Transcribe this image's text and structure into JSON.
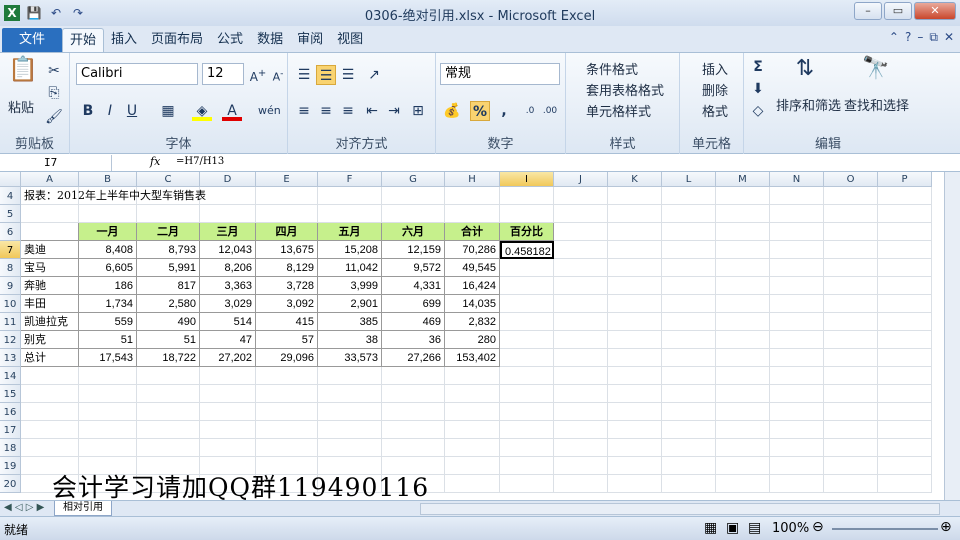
{
  "window": {
    "title": "0306-绝对引用.xlsx - Microsoft Excel"
  },
  "tabs": [
    "文件",
    "开始",
    "插入",
    "页面布局",
    "公式",
    "数据",
    "审阅",
    "视图"
  ],
  "ribbon": {
    "clipboard": {
      "label": "剪贴板",
      "paste": "粘贴"
    },
    "font": {
      "label": "字体",
      "name": "Calibri",
      "size": "12"
    },
    "align": {
      "label": "对齐方式"
    },
    "number": {
      "label": "数字",
      "format": "常规"
    },
    "styles": {
      "label": "样式",
      "cond": "条件格式",
      "table": "套用表格格式",
      "cell": "单元格样式"
    },
    "cells": {
      "label": "单元格",
      "insert": "插入",
      "delete": "删除",
      "format": "格式"
    },
    "edit": {
      "label": "编辑",
      "sort": "排序和筛选",
      "find": "查找和选择"
    }
  },
  "formula": {
    "namebox": "I7",
    "fx": "fx",
    "text": "=H7/H13"
  },
  "sheet": {
    "columns": [
      "A",
      "B",
      "C",
      "D",
      "E",
      "F",
      "G",
      "H",
      "I",
      "J",
      "K",
      "L",
      "M",
      "N",
      "O",
      "P"
    ],
    "rows": [
      "4",
      "5",
      "6",
      "7",
      "8",
      "9",
      "10",
      "11",
      "12",
      "13",
      "14",
      "15",
      "16",
      "17",
      "18",
      "19",
      "20"
    ],
    "title": "报表：2012年上半年中大型车销售表",
    "headers": [
      "一月",
      "二月",
      "三月",
      "四月",
      "五月",
      "六月",
      "合计",
      "百分比"
    ],
    "data": [
      [
        "奥迪",
        "8,408",
        "8,793",
        "12,043",
        "13,675",
        "15,208",
        "12,159",
        "70,286",
        "0.458182"
      ],
      [
        "宝马",
        "6,605",
        "5,991",
        "8,206",
        "8,129",
        "11,042",
        "9,572",
        "49,545",
        ""
      ],
      [
        "奔驰",
        "186",
        "817",
        "3,363",
        "3,728",
        "3,999",
        "4,331",
        "16,424",
        ""
      ],
      [
        "丰田",
        "1,734",
        "2,580",
        "3,029",
        "3,092",
        "2,901",
        "699",
        "14,035",
        ""
      ],
      [
        "凯迪拉克",
        "559",
        "490",
        "514",
        "415",
        "385",
        "469",
        "2,832",
        ""
      ],
      [
        "别克",
        "51",
        "51",
        "47",
        "57",
        "38",
        "36",
        "280",
        ""
      ],
      [
        "总计",
        "17,543",
        "18,722",
        "27,202",
        "29,096",
        "33,573",
        "27,266",
        "153,402",
        ""
      ]
    ]
  },
  "sheettab": "相对引用",
  "status": {
    "ready": "就绪",
    "zoom": "100%"
  },
  "watermark": "会计学习请加QQ群119490116"
}
